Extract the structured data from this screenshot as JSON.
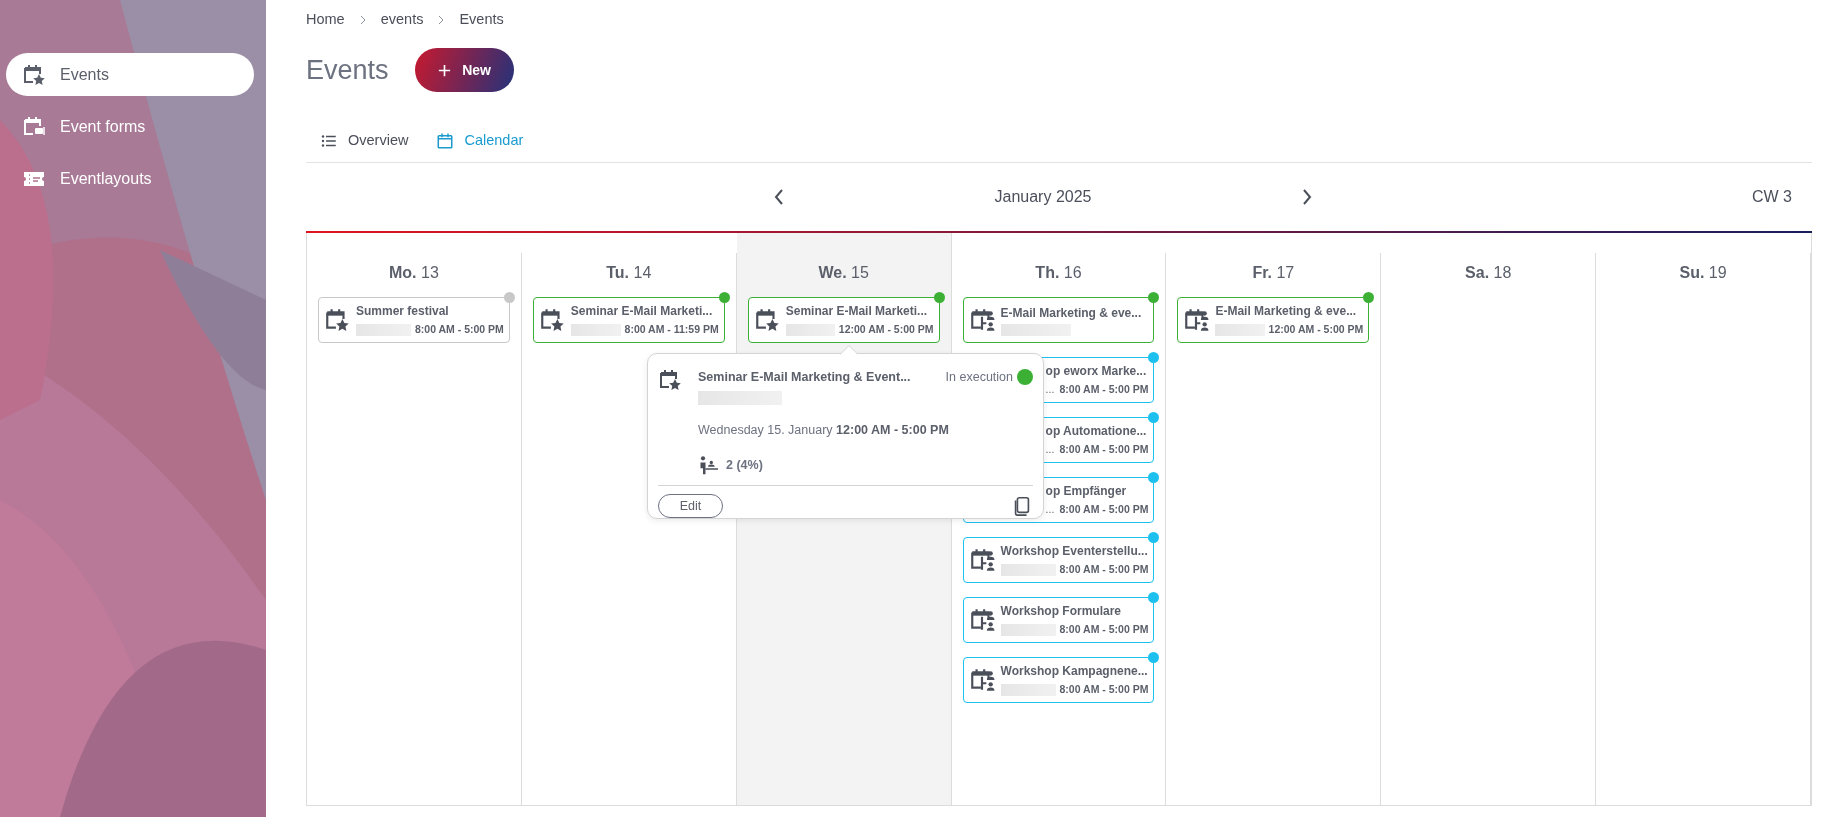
{
  "sidebar": {
    "items": [
      {
        "label": "Events",
        "kind": "events",
        "selected": true
      },
      {
        "label": "Event forms",
        "kind": "forms",
        "selected": false
      },
      {
        "label": "Eventlayouts",
        "kind": "layouts",
        "selected": false
      }
    ]
  },
  "breadcrumb": [
    "Home",
    "events",
    "Events"
  ],
  "page_title": "Events",
  "new_button": "New",
  "tabs": [
    {
      "label": "Overview",
      "kind": "list",
      "selected": false
    },
    {
      "label": "Calendar",
      "kind": "calendar",
      "selected": true
    }
  ],
  "calendar_nav": {
    "month": "January 2025",
    "week": "CW 3"
  },
  "days": [
    {
      "weekday": "Mo.",
      "day": "13",
      "selected": false,
      "events": [
        {
          "kind": "single",
          "title": "Summer festival",
          "time": "8:00 AM - 5:00 PM",
          "color": "#c8c8c8"
        }
      ]
    },
    {
      "weekday": "Tu.",
      "day": "14",
      "selected": false,
      "events": [
        {
          "kind": "single",
          "title": "Seminar E-Mail Marketi...",
          "time": "8:00 AM - 11:59 PM",
          "color": "#3cb035"
        }
      ]
    },
    {
      "weekday": "We.",
      "day": "15",
      "selected": true,
      "events": [
        {
          "kind": "single",
          "title": "Seminar E-Mail Marketi...",
          "time": "12:00 AM - 5:00 PM",
          "color": "#3cb035"
        }
      ]
    },
    {
      "weekday": "Th.",
      "day": "16",
      "selected": false,
      "events": [
        {
          "kind": "series",
          "title": "E-Mail Marketing & eve...",
          "color": "#3cb035"
        },
        {
          "kind": "covered",
          "title": "op eworx Marke...",
          "location": "...",
          "time": "8:00 AM - 5:00 PM",
          "color": "#1ec0f0"
        },
        {
          "kind": "covered",
          "title": "op Automatione...",
          "location": "...",
          "time": "8:00 AM - 5:00 PM",
          "color": "#1ec0f0"
        },
        {
          "kind": "covered",
          "title": "op Empfänger",
          "location": "...",
          "time": "8:00 AM - 5:00 PM",
          "color": "#1ec0f0"
        },
        {
          "kind": "series",
          "title": "Workshop Eventerstellu...",
          "time": "8:00 AM - 5:00 PM",
          "color": "#1ec0f0"
        },
        {
          "kind": "series",
          "title": "Workshop Formulare",
          "time": "8:00 AM - 5:00 PM",
          "color": "#1ec0f0"
        },
        {
          "kind": "series",
          "title": "Workshop Kampagnene...",
          "time": "8:00 AM - 5:00 PM",
          "color": "#1ec0f0"
        }
      ]
    },
    {
      "weekday": "Fr.",
      "day": "17",
      "selected": false,
      "events": [
        {
          "kind": "series",
          "title": "E-Mail Marketing & eve...",
          "time": "12:00 AM - 5:00 PM",
          "color": "#3cb035"
        }
      ]
    },
    {
      "weekday": "Sa.",
      "day": "18",
      "selected": false
    },
    {
      "weekday": "Su.",
      "day": "19",
      "selected": false
    }
  ],
  "popup": {
    "title": "Seminar E-Mail Marketing & Event...",
    "status": "In execution",
    "when": "Wednesday 15. January **12:00 AM - 5:00 PM**",
    "participants": "2 (4%)",
    "edit_button": "Edit"
  }
}
